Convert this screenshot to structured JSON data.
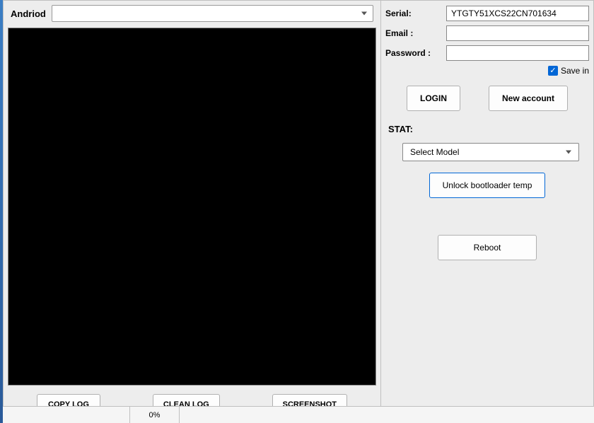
{
  "left": {
    "androidLabel": "Andriod",
    "dropdownValue": "",
    "copyLogLabel": "COPY LOG",
    "cleanLogLabel": "CLEAN LOG",
    "screenshotLabel": "SCREENSHOT"
  },
  "right": {
    "serialLabel": "Serial:",
    "serialValue": "YTGTY51XCS22CN701634",
    "emailLabel": "Email :",
    "emailValue": "",
    "passwordLabel": "Password :",
    "passwordValue": "",
    "saveLabel": "Save in",
    "loginLabel": "LOGIN",
    "newAccountLabel": "New account",
    "statLabel": "STAT:",
    "modelSelectLabel": "Select Model",
    "unlockLabel": "Unlock bootloader temp",
    "rebootLabel": "Reboot"
  },
  "status": {
    "percent": "0%"
  }
}
